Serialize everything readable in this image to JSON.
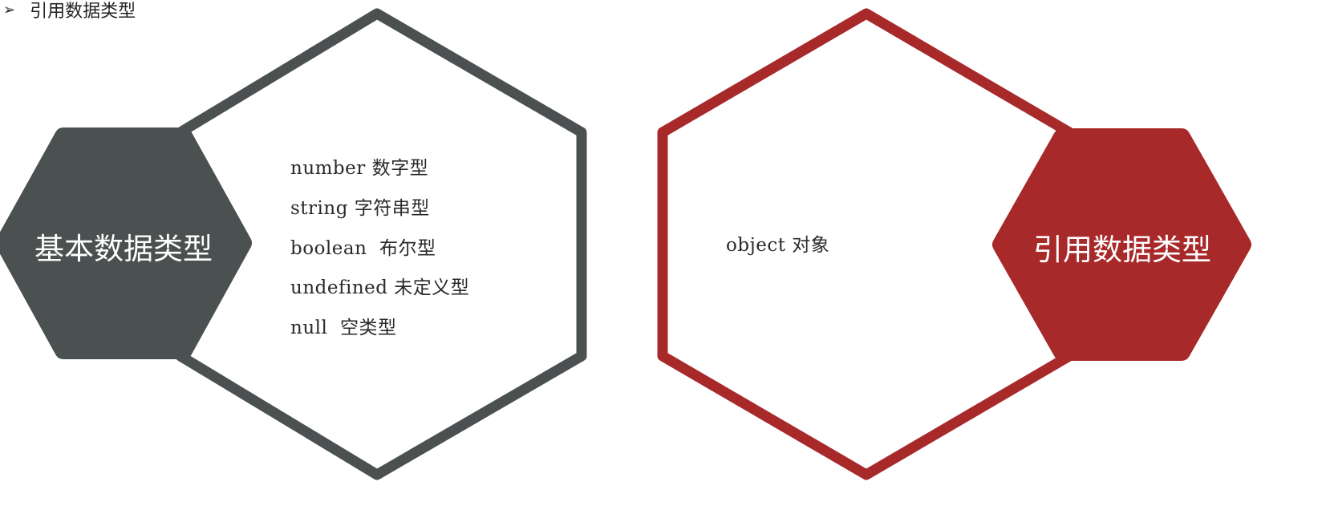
{
  "header": {
    "bullet": "➢",
    "text": "引用数据类型"
  },
  "left_group": {
    "title": "基本数据类型",
    "color": "#4b5050",
    "items": [
      "number 数字型",
      "string 字符串型",
      "boolean  布尔型",
      "undefined 未定义型",
      "null  空类型"
    ]
  },
  "right_group": {
    "title": "引用数据类型",
    "color": "#a8292a",
    "items": [
      "object 对象"
    ]
  }
}
